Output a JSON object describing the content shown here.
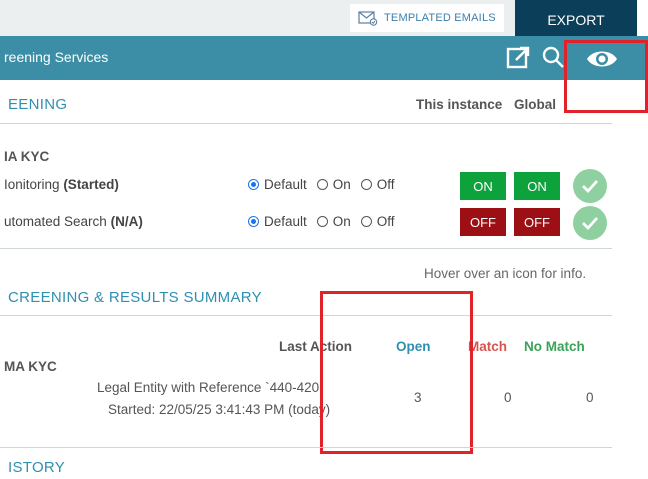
{
  "toolbar": {
    "templated_emails_label": "TEMPLATED EMAILS",
    "export_label": "EXPORT"
  },
  "header": {
    "title": "reening Services",
    "icons": [
      "external-link-icon",
      "search-icon",
      "eye-icon"
    ]
  },
  "screening": {
    "title": "EENING",
    "col_instance": "This instance",
    "col_global": "Global",
    "group_label": "IA KYC",
    "rows": [
      {
        "label": "Ionitoring",
        "status": "(Started)",
        "options": [
          "Default",
          "On",
          "Off"
        ],
        "selected": "Default",
        "instance_state": "ON",
        "global_state": "ON"
      },
      {
        "label": "utomated Search",
        "status": "(N/A)",
        "options": [
          "Default",
          "On",
          "Off"
        ],
        "selected": "Default",
        "instance_state": "OFF",
        "global_state": "OFF"
      }
    ]
  },
  "summary": {
    "hint": "Hover over an icon for info.",
    "title": "CREENING & RESULTS SUMMARY",
    "headers": {
      "last_action": "Last Action",
      "open": "Open",
      "match": "Match",
      "no_match": "No Match"
    },
    "group_label": "MA KYC",
    "row": {
      "action_line1": "Legal Entity with Reference `440-420`",
      "action_line2": "Started: 22/05/25 3:41:43 PM (today)",
      "open": "3",
      "match": "0",
      "no_match": "0"
    }
  },
  "history": {
    "title": "ISTORY"
  },
  "colors": {
    "header_bg": "#3b8ea5",
    "export_bg": "#0b3e58",
    "on": "#0ea23c",
    "off": "#9c0f14",
    "accent": "#2f8fb0",
    "match": "#d9534f",
    "no_match": "#3aa35a",
    "highlight_box": "#e0232a"
  }
}
